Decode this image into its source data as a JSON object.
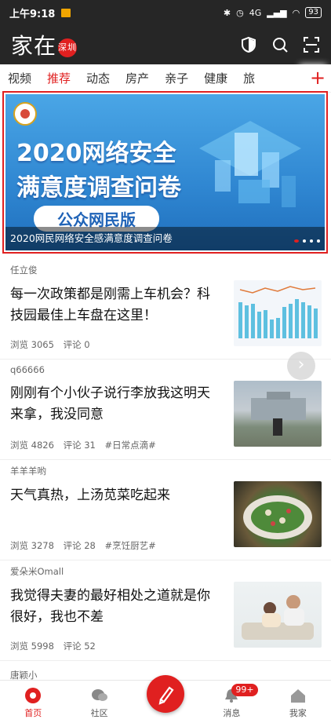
{
  "status_bar": {
    "time": "上午9:18",
    "network": "4G",
    "battery": "93"
  },
  "app_bar": {
    "logo": "家在",
    "city": "深圳"
  },
  "tabs": [
    {
      "label": "视频"
    },
    {
      "label": "推荐",
      "active": true
    },
    {
      "label": "动态"
    },
    {
      "label": "房产"
    },
    {
      "label": "亲子"
    },
    {
      "label": "健康"
    },
    {
      "label": "旅"
    }
  ],
  "banner": {
    "headline_line1": "2020网络安全",
    "headline_line2": "满意度调查问卷",
    "badge": "公众网民版",
    "caption": "2020网民网络安全感满意度调查问卷"
  },
  "feed": [
    {
      "author": "任立俊",
      "title": "每一次政策都是刚需上车机会？科技园最佳上车盘在这里！",
      "views": "浏览 3065",
      "comments": "评论 0",
      "tag": ""
    },
    {
      "author": "q66666",
      "title": "刚刚有个小伙子说行李放我这明天来拿，我没同意",
      "views": "浏览 4826",
      "comments": "评论 31",
      "tag": "#日常点滴#"
    },
    {
      "author": "羊羊羊哟",
      "title": "天气真热，上汤苋菜吃起来",
      "views": "浏览 3278",
      "comments": "评论 28",
      "tag": "#烹饪厨艺#"
    },
    {
      "author": "爱朵米Omall",
      "title": "我觉得夫妻的最好相处之道就是你很好，我也不差",
      "views": "浏览 5998",
      "comments": "评论 52",
      "tag": ""
    }
  ],
  "partial_author": "唐颖小",
  "bottom_nav": {
    "home": "首页",
    "community": "社区",
    "messages": "消息",
    "messages_badge": "99+",
    "mine": "我家"
  },
  "colors": {
    "brand_red": "#e02020",
    "header_dark": "#262626"
  }
}
